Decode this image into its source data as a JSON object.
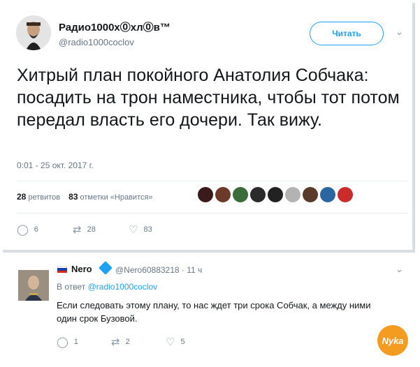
{
  "tweet": {
    "author_name": "Радио1000х⓪хл⓪в™",
    "author_handle": "@radio1000coclov",
    "follow_label": "Читать",
    "text": "Хитрый план покойного Анатолия Собчака: посадить на трон наместника, чтобы тот потом передал власть его дочери. Так вижу.",
    "timestamp": "0:01 - 25 окт. 2017 г.",
    "retweets_count": "28",
    "retweets_label": "ретвитов",
    "likes_count": "83",
    "likes_label": "отметки «Нравится»",
    "liker_avatar_colors": [
      "#3a1a1a",
      "#6b3a2a",
      "#3b6b3b",
      "#2b2b2b",
      "#222222",
      "#b3b3b3",
      "#5a3b2a",
      "#2b66a3",
      "#cc2b2b"
    ],
    "actions": {
      "reply_count": "6",
      "retweet_count": "28",
      "like_count": "83"
    }
  },
  "reply": {
    "author_name": "Nero",
    "author_handle": "@Nero60883218 · 11 ч",
    "in_reply_prefix": "В ответ",
    "in_reply_handle": "@radio1000coclov",
    "text": "Если следовать этому плану, то нас ждет три срока Собчак, а между ними один срок Бузовой.",
    "actions": {
      "reply_count": "1",
      "retweet_count": "2",
      "like_count": "5"
    }
  },
  "watermark": "Nyka"
}
